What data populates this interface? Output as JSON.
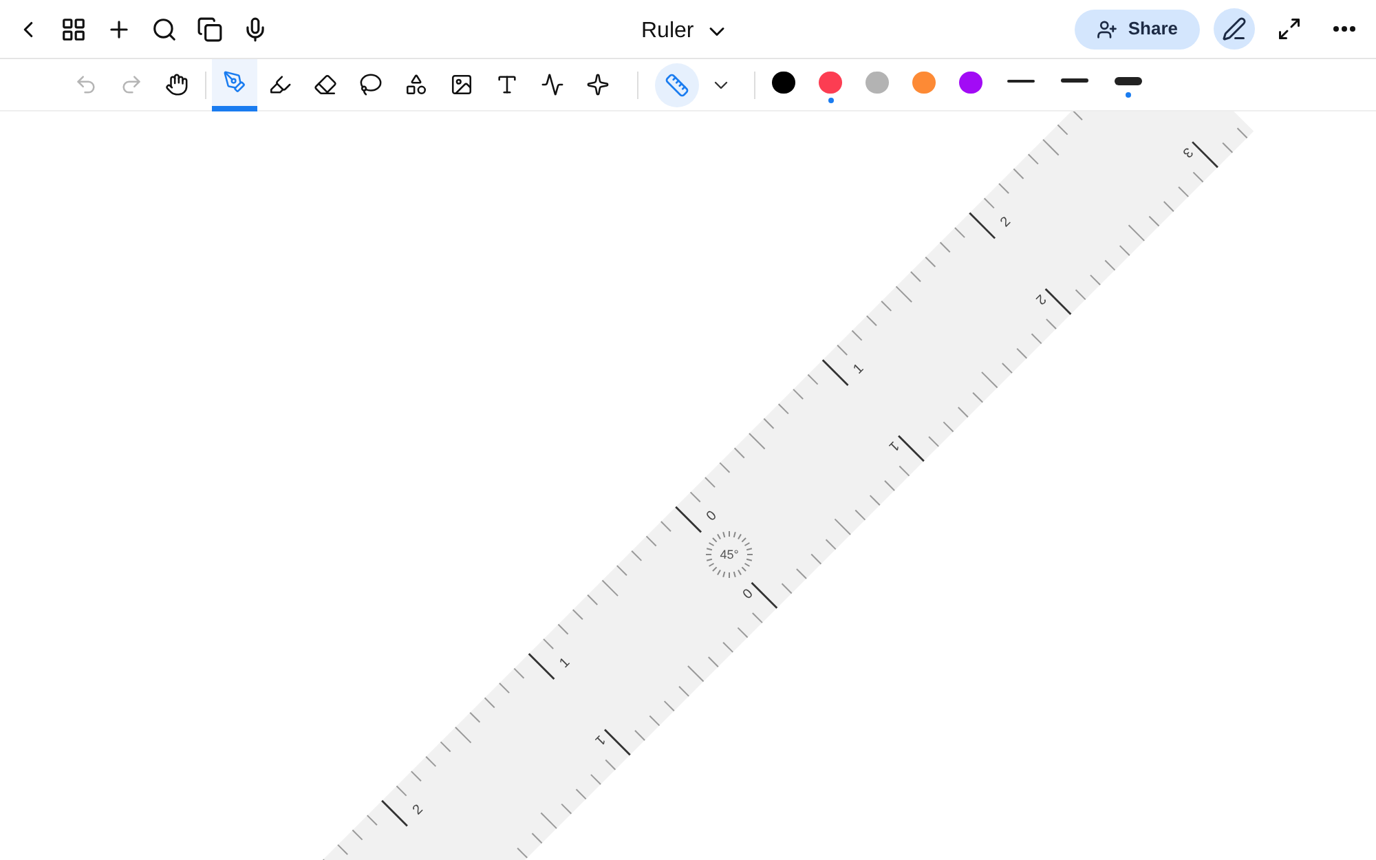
{
  "title": "Ruler",
  "nav_buttons": [
    {
      "kind": "back"
    },
    {
      "kind": "grid"
    },
    {
      "kind": "add"
    },
    {
      "kind": "search"
    },
    {
      "kind": "pages"
    },
    {
      "kind": "mic"
    }
  ],
  "share": {
    "label": "Share"
  },
  "right_buttons": [
    {
      "kind": "pen-mode",
      "selected": true
    },
    {
      "kind": "expand",
      "selected": false
    },
    {
      "kind": "more",
      "selected": false
    }
  ],
  "tools": [
    {
      "kind": "undo",
      "selected": false,
      "disabled": true
    },
    {
      "kind": "redo",
      "selected": false,
      "disabled": true
    },
    {
      "kind": "hand",
      "selected": false,
      "disabled": false
    },
    {
      "kind": "pen",
      "selected": true,
      "disabled": false
    },
    {
      "kind": "highlighter",
      "selected": false,
      "disabled": false
    },
    {
      "kind": "eraser",
      "selected": false,
      "disabled": false
    },
    {
      "kind": "lasso",
      "selected": false,
      "disabled": false
    },
    {
      "kind": "shapes",
      "selected": false,
      "disabled": false
    },
    {
      "kind": "image",
      "selected": false,
      "disabled": false
    },
    {
      "kind": "text",
      "selected": false,
      "disabled": false
    },
    {
      "kind": "chart",
      "selected": false,
      "disabled": false
    },
    {
      "kind": "laser",
      "selected": false,
      "disabled": false
    }
  ],
  "ruler_tool": {
    "on": true
  },
  "colors": [
    {
      "color": "#000000",
      "selected": false
    },
    {
      "color": "#fc3d52",
      "selected": true
    },
    {
      "color": "#b3b3b3",
      "selected": false
    },
    {
      "color": "#fd8a35",
      "selected": false
    },
    {
      "color": "#a20bf5",
      "selected": false
    }
  ],
  "strokes": [
    {
      "kind": "thin",
      "selected": false
    },
    {
      "kind": "medium",
      "selected": false
    },
    {
      "kind": "thick",
      "selected": true
    }
  ],
  "ruler": {
    "angle": "45°",
    "top_scale": [
      "2",
      "1",
      "0",
      "1",
      "2"
    ],
    "bottom_scale": [
      "1",
      "0",
      "1",
      "2",
      "3"
    ]
  }
}
